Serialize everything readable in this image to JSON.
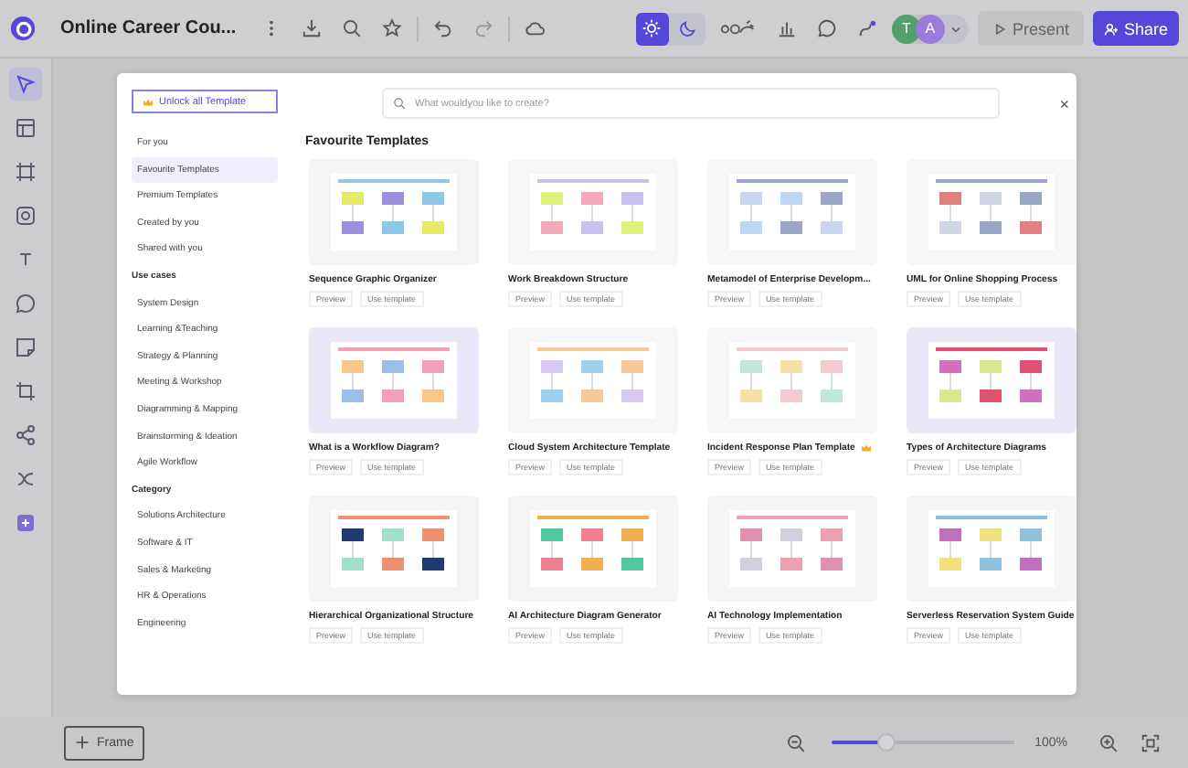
{
  "topbar": {
    "title": "Online Career Cou...",
    "theme_modes": [
      {
        "kind": "sun",
        "selected": true
      },
      {
        "kind": "moon",
        "selected": false
      }
    ],
    "avatars": [
      "T",
      "A"
    ],
    "present": "Present",
    "share": "Share"
  },
  "rail": {
    "tools": [
      {
        "kind": "cursor",
        "selected": true
      },
      {
        "kind": "template",
        "selected": false
      },
      {
        "kind": "frame",
        "selected": false
      },
      {
        "kind": "shape",
        "selected": false
      },
      {
        "kind": "text",
        "selected": false
      },
      {
        "kind": "comment",
        "selected": false
      },
      {
        "kind": "note",
        "selected": false
      },
      {
        "kind": "crop",
        "selected": false
      },
      {
        "kind": "share",
        "selected": false
      },
      {
        "kind": "flow",
        "selected": false
      },
      {
        "kind": "plus",
        "selected": false
      }
    ]
  },
  "modal": {
    "unlock": "Unlock all Template",
    "search": {
      "placeholder": "What wouldyou like to create?"
    },
    "close": "×",
    "nav": [
      {
        "items": [
          {
            "label": "For you",
            "selected": false
          },
          {
            "label": "Favourite Templates",
            "selected": true
          },
          {
            "label": "Premium Templates",
            "selected": false
          },
          {
            "label": "Created by you",
            "selected": false
          },
          {
            "label": "Shared with you",
            "selected": false
          }
        ]
      },
      {
        "heading": "Use cases",
        "items": [
          {
            "label": "System Design",
            "selected": false
          },
          {
            "label": "Learning &Teaching",
            "selected": false
          },
          {
            "label": "Strategy & Planning",
            "selected": false
          },
          {
            "label": "Meeting & Workshop",
            "selected": false
          },
          {
            "label": "Diagramming & Mapping",
            "selected": false
          },
          {
            "label": "Brainstorming & Ideation",
            "selected": false
          },
          {
            "label": "Agile Workflow",
            "selected": false
          }
        ]
      },
      {
        "heading": "Category",
        "items": [
          {
            "label": "Solutions Architecture",
            "selected": false
          },
          {
            "label": "Software & IT",
            "selected": false
          },
          {
            "label": "Sales & Marketing",
            "selected": false
          },
          {
            "label": "HR & Operations",
            "selected": false
          },
          {
            "label": "Engineering",
            "selected": false
          }
        ]
      }
    ],
    "heading": "Favourite Templates",
    "templates": [
      {
        "title": "Sequence Graphic Organizer",
        "starred": false,
        "actions": [
          "Preview",
          "Use template"
        ]
      },
      {
        "title": "Work Breakdown Structure",
        "starred": false,
        "actions": [
          "Preview",
          "Use template"
        ]
      },
      {
        "title": "Metamodel of Enterprise Developm...",
        "starred": false,
        "actions": [
          "Preview",
          "Use template"
        ]
      },
      {
        "title": "UML for Online Shopping Process",
        "starred": false,
        "actions": [
          "Preview",
          "Use template"
        ]
      },
      {
        "title": "What is a Workflow Diagram?",
        "starred": false,
        "actions": [
          "Preview",
          "Use template"
        ]
      },
      {
        "title": "Cloud System Architecture Template",
        "starred": false,
        "actions": [
          "Preview",
          "Use template"
        ]
      },
      {
        "title": "Incident Response Plan Template",
        "starred": true,
        "actions": [
          "Preview",
          "Use template"
        ]
      },
      {
        "title": "Types of Architecture Diagrams",
        "starred": false,
        "actions": [
          "Preview",
          "Use template"
        ]
      },
      {
        "title": "Hierarchical Organizational Structure",
        "starred": false,
        "actions": [
          "Preview",
          "Use template"
        ]
      },
      {
        "title": "AI Architecture Diagram Generator",
        "starred": false,
        "actions": [
          "Preview",
          "Use template"
        ]
      },
      {
        "title": "AI Technology Implementation",
        "starred": false,
        "actions": [
          "Preview",
          "Use template"
        ]
      },
      {
        "title": "Serverless Reservation System Guide",
        "starred": false,
        "actions": [
          "Preview",
          "Use template"
        ]
      }
    ]
  },
  "bottombar": {
    "frame": "Frame",
    "zoom": {
      "level": 0.3
    },
    "zoom_reading": "100%"
  }
}
